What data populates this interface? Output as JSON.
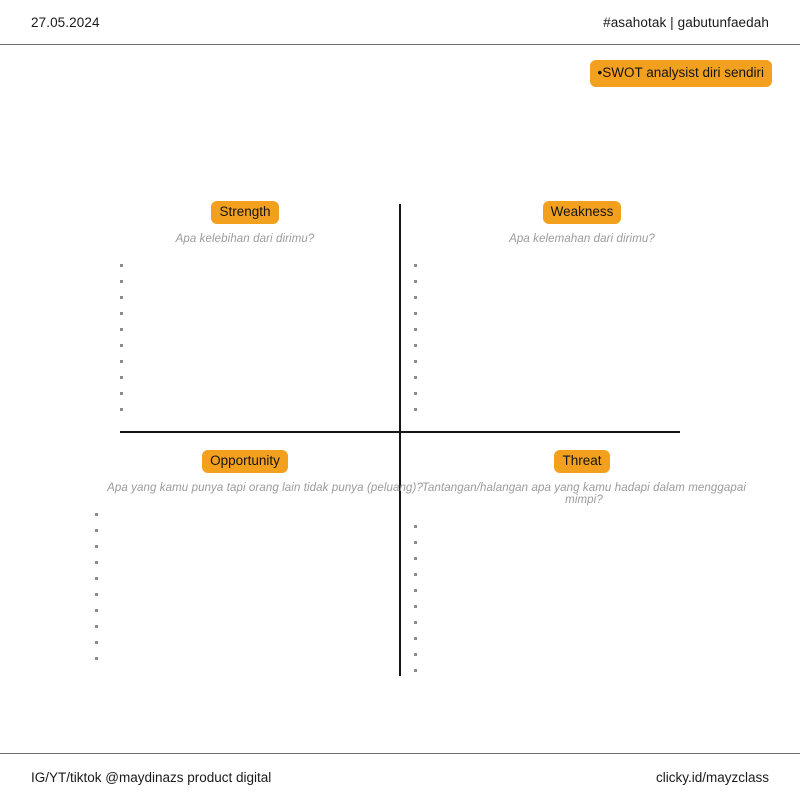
{
  "colors": {
    "accent": "#F2A01E",
    "text": "#1a1a1a",
    "muted": "#9b9b9b",
    "rule": "#6f6f6f",
    "line": "#141414",
    "background": "#ffffff"
  },
  "header": {
    "date": "27.05.2024",
    "handle": "#asahotak | gabutunfaedah"
  },
  "title": {
    "badge_label": "•SWOT analysist diri sendiri"
  },
  "quadrants": [
    {
      "id": "strength",
      "label": "Strength",
      "prompt": "Apa kelebihan dari dirimu?",
      "bullet_count": 10
    },
    {
      "id": "weakness",
      "label": "Weakness",
      "prompt": "Apa kelemahan dari dirimu?",
      "bullet_count": 10
    },
    {
      "id": "opportunity",
      "label": "Opportunity",
      "prompt": "Apa yang kamu punya tapi orang lain tidak punya (peluang)?",
      "bullet_count": 10
    },
    {
      "id": "threat",
      "label": "Threat",
      "prompt": "Tantangan/halangan apa yang kamu hadapi dalam menggapai mimpi?",
      "bullet_count": 10
    }
  ],
  "footer": {
    "left": "IG/YT/tiktok @maydinazs product digital",
    "right": "clicky.id/mayzclass"
  }
}
